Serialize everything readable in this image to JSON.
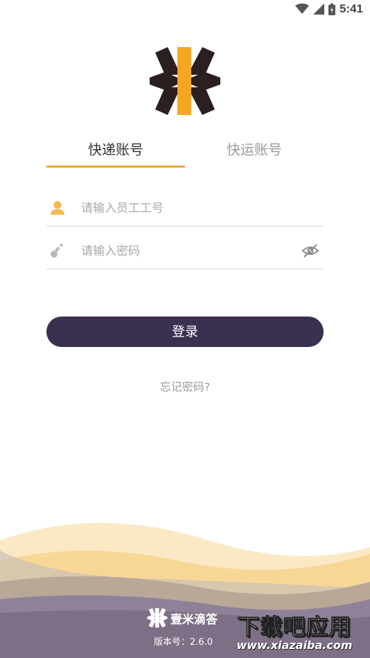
{
  "status_bar": {
    "time": "5:41",
    "icons": [
      "wifi-icon",
      "signal-icon",
      "battery-icon"
    ]
  },
  "tabs": [
    {
      "label": "快递账号",
      "active": true
    },
    {
      "label": "快运账号",
      "active": false
    }
  ],
  "form": {
    "employee_id": {
      "placeholder": "请输入员工工号",
      "value": "",
      "icon": "user-icon"
    },
    "password": {
      "placeholder": "请输入密码",
      "value": "",
      "icon": "key-icon",
      "toggle_icon": "eye-hidden-icon"
    }
  },
  "login_button": "登录",
  "forgot_password": "忘记密码?",
  "footer": {
    "brand_name": "壹米滴答",
    "version": "版本号：2.6.0"
  },
  "watermark": {
    "title": "下载吧应用",
    "url": "www.xiazaiba.com"
  },
  "colors": {
    "accent": "#f2a646",
    "button": "#3c3050",
    "logo_dark": "#2b1f1f",
    "logo_yellow": "#f5a623"
  }
}
